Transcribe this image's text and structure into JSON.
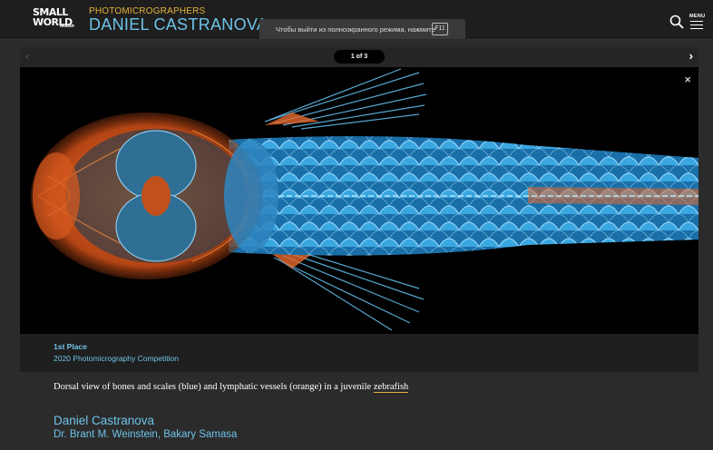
{
  "header": {
    "logo": {
      "line1": "SMALL",
      "line2": "WORLD",
      "line3": "Nikon"
    },
    "category": "PHOTOMICROGRAPHERS",
    "photographer": "DANIEL CASTRANOVA",
    "fullscreen_notice": {
      "text": "Чтобы выйти из полноэкранного режима, нажмите",
      "key": "F11"
    },
    "search_icon": "search-icon",
    "menu_label": "MENU"
  },
  "gallery": {
    "counter": "1 of 3",
    "prev_icon": "‹",
    "next_icon": "›",
    "close_icon": "×"
  },
  "award": {
    "place": "1st Place",
    "competition": "2020 Photomicrography Competition"
  },
  "caption": {
    "text_before": "Dorsal view of bones and scales (blue) and lymphatic vessels (orange) in a juvenile ",
    "link_text": "zebrafish"
  },
  "credits": {
    "name": "Daniel Castranova",
    "coauthors": "Dr. Brant M. Weinstein, Bakary Samasa"
  },
  "colors": {
    "accent_blue": "#6ec3e8",
    "accent_gold": "#e3b33a",
    "orange": "#e8682a",
    "scale_blue": "#3aa7e0"
  }
}
